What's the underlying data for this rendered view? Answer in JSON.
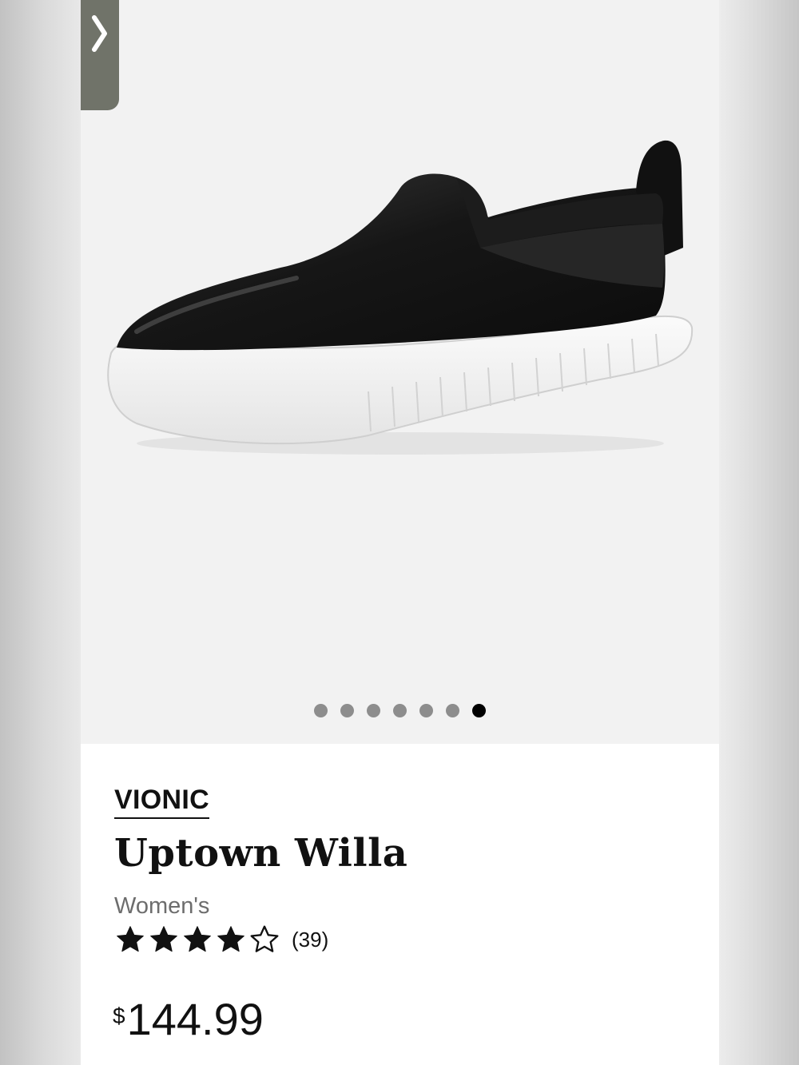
{
  "gallery": {
    "image_alt": "Vionic Uptown Willa black leather slip-on shoe",
    "dots_total": 7,
    "active_index": 6
  },
  "product": {
    "brand": "VIONIC",
    "name": "Uptown Willa",
    "gender": "Women's",
    "rating": 4,
    "rating_max": 5,
    "review_count_label": "(39)",
    "currency_symbol": "$",
    "price": "144.99"
  },
  "icons": {
    "next": "chevron-right-icon",
    "star_filled": "star-filled-icon",
    "star_empty": "star-outline-icon"
  },
  "colors": {
    "tab": "#707369",
    "dot": "#8d8d8d",
    "dot_active": "#000000",
    "text": "#111111",
    "muted": "#6d6d6d"
  }
}
